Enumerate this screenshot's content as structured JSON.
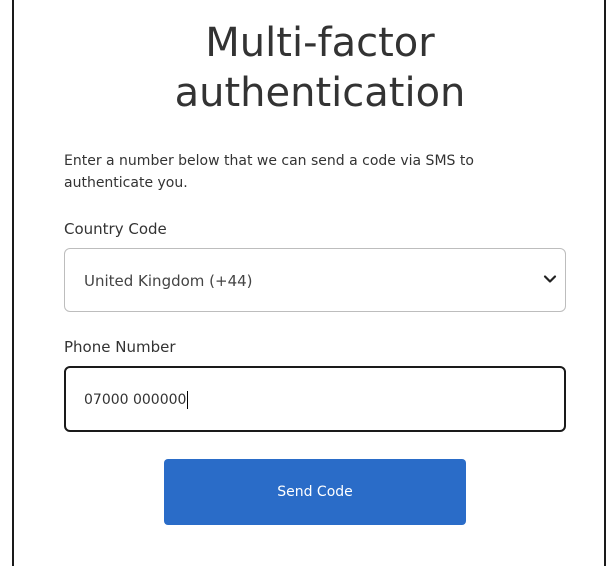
{
  "header": {
    "title_line1": "Multi-factor",
    "title_line2": "authentication"
  },
  "description": "Enter a number below that we can send a code via SMS to authenticate you.",
  "country_field": {
    "label": "Country Code",
    "selected_value": "United Kingdom (+44)"
  },
  "phone_field": {
    "label": "Phone Number",
    "value": "07000 000000"
  },
  "actions": {
    "send_label": "Send Code"
  },
  "colors": {
    "primary_button": "#2a6cc8",
    "text": "#333333",
    "frame_border": "#1a1a1a"
  }
}
